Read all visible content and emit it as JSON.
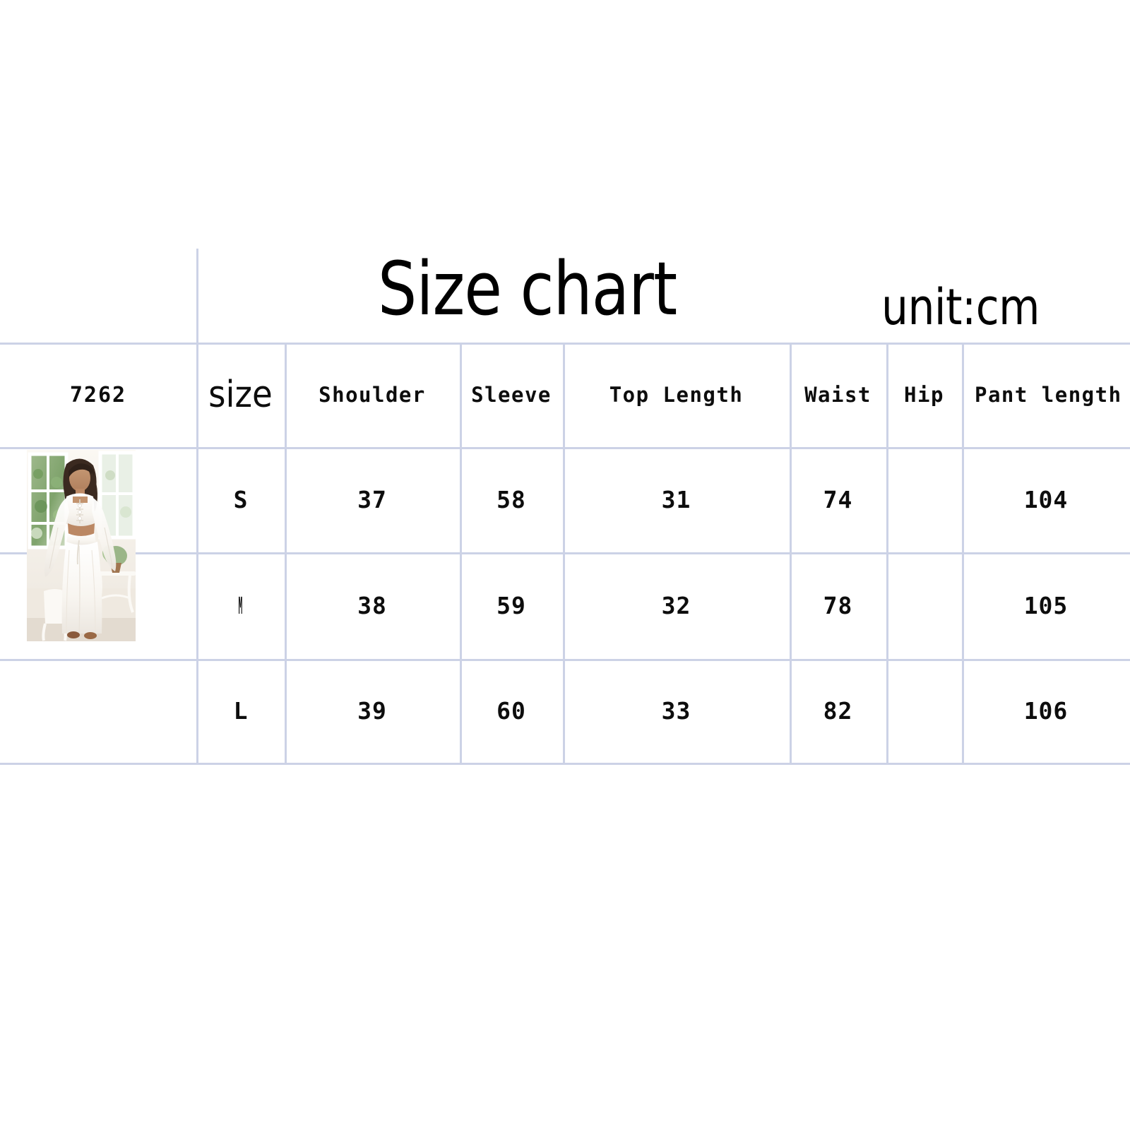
{
  "title": "Size chart",
  "unit_label": "unit:cm",
  "sku": "7262",
  "colors": {
    "grid_line": "#ccd2e6",
    "text": "#0d0d0d",
    "background": "#ffffff"
  },
  "table": {
    "headers": [
      "7262",
      "size",
      "Shoulder",
      "Sleeve",
      "Top Length",
      "Waist",
      "Hip",
      "Pant length"
    ],
    "rows": [
      {
        "size": "S",
        "shoulder": "37",
        "sleeve": "58",
        "top_length": "31",
        "waist": "74",
        "hip": "",
        "pant_length": "104"
      },
      {
        "size": "M",
        "shoulder": "38",
        "sleeve": "59",
        "top_length": "32",
        "waist": "78",
        "hip": "",
        "pant_length": "105"
      },
      {
        "size": "L",
        "shoulder": "39",
        "sleeve": "60",
        "top_length": "33",
        "waist": "82",
        "hip": "",
        "pant_length": "106"
      }
    ]
  },
  "product_image": {
    "alt": "Model wearing white knit crop top with bell sleeves and matching long white maxi skirt in a bright sunroom"
  }
}
